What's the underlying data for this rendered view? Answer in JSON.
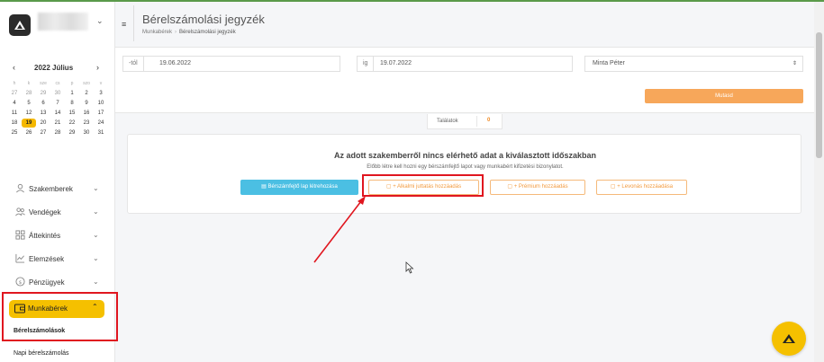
{
  "header": {
    "title": "Bérelszámolási jegyzék",
    "breadcrumb": [
      "Munkabérek",
      "Bérelszámolási jegyzék"
    ]
  },
  "calendar": {
    "month_title": "2022 Július",
    "prev": "‹",
    "next": "›",
    "weekdays": [
      "h",
      "k",
      "sze",
      "cs",
      "p",
      "szo",
      "v"
    ],
    "rows": [
      [
        "27",
        "28",
        "29",
        "30",
        "1",
        "2",
        "3"
      ],
      [
        "4",
        "5",
        "6",
        "7",
        "8",
        "9",
        "10"
      ],
      [
        "11",
        "12",
        "13",
        "14",
        "15",
        "16",
        "17"
      ],
      [
        "18",
        "19",
        "20",
        "21",
        "22",
        "23",
        "24"
      ],
      [
        "25",
        "26",
        "27",
        "28",
        "29",
        "30",
        "31"
      ]
    ],
    "selected_day": "19"
  },
  "sidebar": {
    "items": [
      {
        "label": "Szakemberek",
        "icon": "user-icon"
      },
      {
        "label": "Vendégek",
        "icon": "users-icon"
      },
      {
        "label": "Áttekintés",
        "icon": "grid-icon"
      },
      {
        "label": "Elemzések",
        "icon": "chart-icon"
      },
      {
        "label": "Pénzügyek",
        "icon": "coin-icon"
      }
    ],
    "active": {
      "label": "Munkabérek",
      "icon": "wallet-icon"
    },
    "sub_items": [
      "Bérelszámolások",
      "Napi bérelszámolás"
    ]
  },
  "filters": {
    "from_prefix": "-tól",
    "from_value": "19.06.2022",
    "to_prefix": "ig",
    "to_value": "19.07.2022",
    "employee_value": "Minta Péter",
    "show_button": "Mutasd"
  },
  "results": {
    "label": "Találatok",
    "count": "0"
  },
  "empty_card": {
    "title": "Az adott szakemberről nincs elérhető adat a kiválasztott időszakban",
    "subtitle": "Előbb létre kell hozni egy bérszámfejtő lapot vagy munkabért kifizetési bizonylatot.",
    "actions": {
      "create_sheet": "Bérszámfejtő lap létrehozása",
      "add_allowance": "+ Alkalmi juttatás hozzáadás",
      "add_premium": "+ Prémium hozzáadás",
      "add_deduction": "+ Levonás hozzáadása"
    }
  },
  "colors": {
    "accent_yellow": "#f5c000",
    "primary_blue": "#4bbfe3",
    "orange": "#f7a75a",
    "highlight_red": "#e0161f"
  }
}
